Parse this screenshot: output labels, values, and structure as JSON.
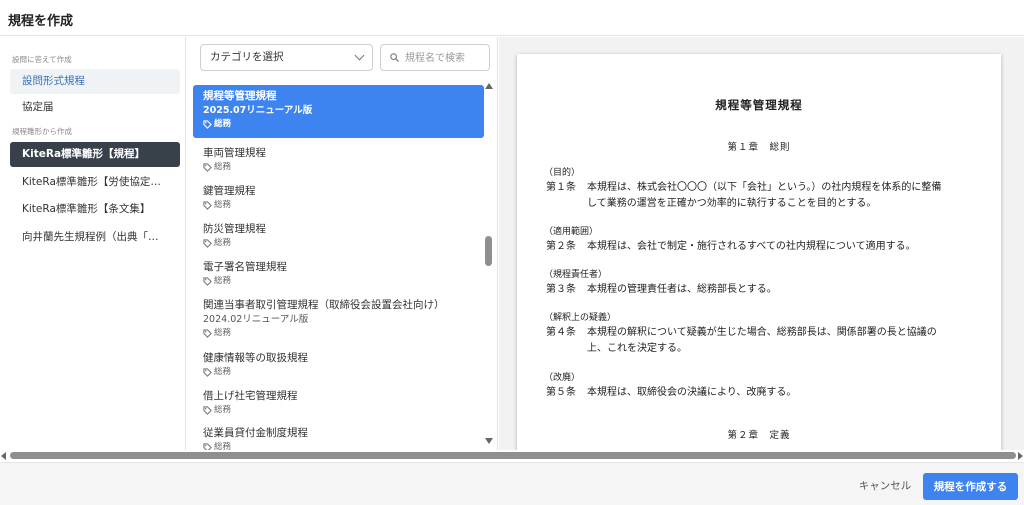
{
  "header": {
    "title": "規程を作成"
  },
  "sidebar": {
    "section1_label": "設問に答えて作成",
    "section2_label": "規程雛形から作成",
    "items": [
      {
        "label": "設問形式規程"
      },
      {
        "label": "協定届"
      },
      {
        "label": "KiteRa標準雛形【規程】"
      },
      {
        "label": "KiteRa標準雛形【労使協定…"
      },
      {
        "label": "KiteRa標準雛形【条文集】"
      },
      {
        "label": "向井蘭先生規程例（出典「…"
      }
    ]
  },
  "filters": {
    "category_value": "カテゴリを選択",
    "search_placeholder": "規程名で検索"
  },
  "list": {
    "items": [
      {
        "name": "規程等管理規程",
        "version": "2025.07リニューアル版",
        "tag": "総務"
      },
      {
        "name": "車両管理規程",
        "tag": "総務"
      },
      {
        "name": "鍵管理規程",
        "tag": "総務"
      },
      {
        "name": "防災管理規程",
        "tag": "総務"
      },
      {
        "name": "電子署名管理規程",
        "tag": "総務"
      },
      {
        "name": "関連当事者取引管理規程（取締役会設置会社向け）",
        "version": "2024.02リニューアル版",
        "tag": "総務"
      },
      {
        "name": "健康情報等の取扱規程",
        "tag": "総務"
      },
      {
        "name": "借上げ社宅管理規程",
        "tag": "総務"
      },
      {
        "name": "従業員貸付金制度規程",
        "tag": "総務"
      }
    ]
  },
  "preview": {
    "title": "規程等管理規程",
    "chapter1": "第１章　総則",
    "chapter2": "第２章　定義",
    "articles": [
      {
        "heading": "（目的）",
        "no": "第１条",
        "lines": [
          "本規程は、株式会社〇〇〇（以下「会社」という。）の社内規程を体系的に整備",
          "して業務の運営を正確かつ効率的に執行することを目的とする。"
        ]
      },
      {
        "heading": "（適用範囲）",
        "no": "第２条",
        "lines": [
          "本規程は、会社で制定・施行されるすべての社内規程について適用する。"
        ]
      },
      {
        "heading": "（規程責任者）",
        "no": "第３条",
        "lines": [
          "本規程の管理責任者は、総務部長とする。"
        ]
      },
      {
        "heading": "（解釈上の疑義）",
        "no": "第４条",
        "lines": [
          "本規程の解釈について疑義が生じた場合、総務部長は、関係部署の長と協議の",
          "上、これを決定する。"
        ]
      },
      {
        "heading": "（改廃）",
        "no": "第５条",
        "lines": [
          "本規程は、取締役会の決議により、改廃する。"
        ]
      }
    ]
  },
  "footer": {
    "cancel_label": "キャンセル",
    "create_label": "規程を作成する"
  },
  "colors": {
    "primary": "#3d84f1",
    "dark_item": "#38404a"
  }
}
